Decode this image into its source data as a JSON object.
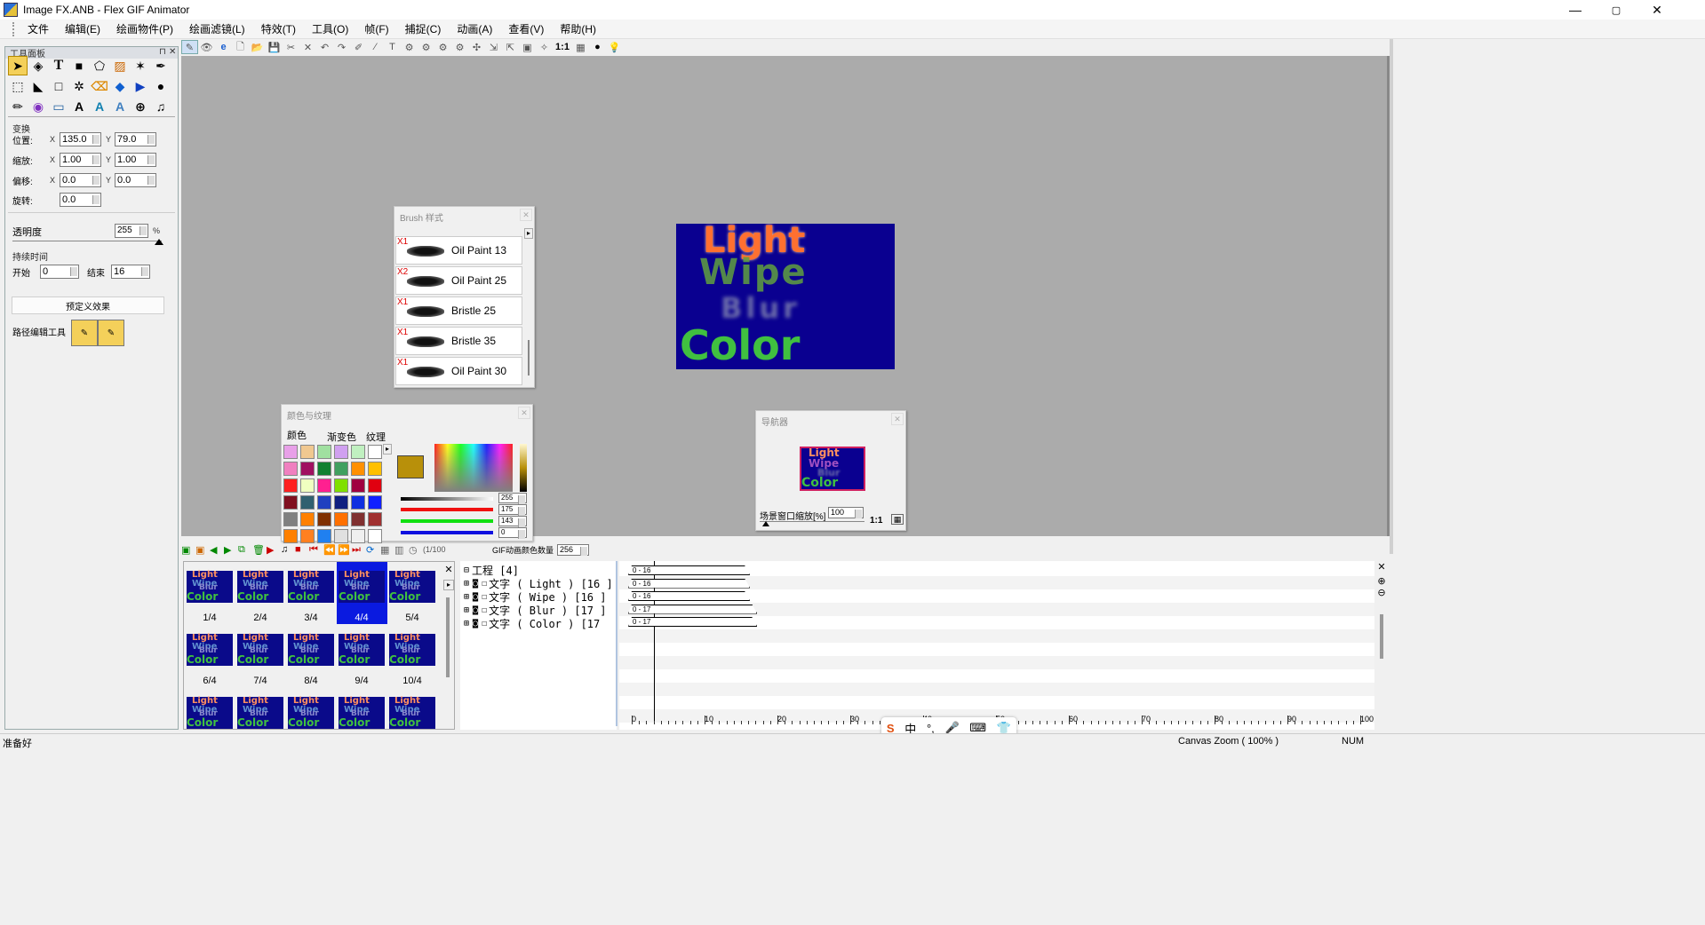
{
  "window": {
    "title": "Image FX.ANB - Flex GIF Animator",
    "min": "—",
    "max": "▢",
    "close": "✕"
  },
  "menu": [
    "文件",
    "编辑(E)",
    "绘画物件(P)",
    "绘画滤镜(L)",
    "特效(T)",
    "工具(O)",
    "帧(F)",
    "捕捉(C)",
    "动画(A)",
    "查看(V)",
    "帮助(H)"
  ],
  "toolpanel": {
    "title": "工具面板",
    "transform_label": "变换",
    "position_label": "位置:",
    "pos_x": "135.0",
    "pos_y": "79.0",
    "scale_label": "缩放:",
    "scale_x": "1.00",
    "scale_y": "1.00",
    "offset_label": "偏移:",
    "offset_x": "0.0",
    "offset_y": "0.0",
    "rotate_label": "旋转:",
    "rotate": "0.0",
    "x": "X",
    "y": "Y",
    "opacity_label": "透明度",
    "opacity_value": "255",
    "percent": "%",
    "duration_label": "持续时间",
    "start_label": "开始",
    "start_value": "0",
    "end_label": "结束",
    "end_value": "16",
    "preset_button": "预定义效果",
    "path_tool_label": "路径编辑工具"
  },
  "brush_window": {
    "title": "Brush 样式",
    "items": [
      {
        "mark": "X1",
        "label": "Oil Paint 13"
      },
      {
        "mark": "X2",
        "label": "Oil Paint 25"
      },
      {
        "mark": "X1",
        "label": "Bristle 25"
      },
      {
        "mark": "X1",
        "label": "Bristle 35"
      },
      {
        "mark": "X1",
        "label": "Oil Paint 30"
      }
    ]
  },
  "color_window": {
    "title": "颜色与纹理",
    "tabs": [
      "颜色",
      "渐变色",
      "纹理"
    ],
    "current_color": "#b8900a",
    "values": [
      "255",
      "175",
      "143",
      "0"
    ],
    "swatches": [
      [
        "#e8a0e8",
        "#f0c890",
        "#a0e0a0",
        "#d0a0f0",
        "#c0f0c0",
        "#ffffff"
      ],
      [
        "#f080c0",
        "#a01060",
        "#108030",
        "#40a060",
        "#ff9000",
        "#ffc000"
      ],
      [
        "#ff2020",
        "#f0ffc0",
        "#ff2090",
        "#80e000",
        "#a00040",
        "#e00010"
      ],
      [
        "#801020",
        "#306070",
        "#2040c0",
        "#102080",
        "#1030e0",
        "#1020ff"
      ],
      [
        "#808080",
        "#ff8000",
        "#803000",
        "#ff7000",
        "#803030",
        "#a03030"
      ],
      [
        "#ff8000",
        "#ff8020",
        "#2080f0",
        "#e0e0e0",
        "#f0f0f0",
        "#ffffff"
      ]
    ]
  },
  "navigator": {
    "title": "导航器",
    "zoom_label": "场景窗口缩放[%]",
    "zoom_value": "100",
    "one_to_one": "1:1"
  },
  "preview": {
    "background": "#0a0090",
    "line1": "Light",
    "line2": "Wipe",
    "line3": "Blur",
    "line4": "Color"
  },
  "bottombar": {
    "frame_counter": "(1/100",
    "gif_colors_label": "GIF动画颜色数量",
    "gif_colors_value": "256"
  },
  "frames": [
    {
      "label": "1/4"
    },
    {
      "label": "2/4"
    },
    {
      "label": "3/4"
    },
    {
      "label": "4/4",
      "selected": true
    },
    {
      "label": "5/4"
    },
    {
      "label": "6/4"
    },
    {
      "label": "7/4"
    },
    {
      "label": "8/4"
    },
    {
      "label": "9/4"
    },
    {
      "label": "10/4"
    },
    {
      "label": ""
    },
    {
      "label": ""
    },
    {
      "label": ""
    },
    {
      "label": ""
    },
    {
      "label": ""
    }
  ],
  "tree": {
    "root": "工程 [4]",
    "rows": [
      "文字 ( Light ) [16 ]",
      "文字 ( Wipe ) [16 ]",
      "文字 ( Blur ) [17 ]",
      "文字 ( Color ) [17"
    ]
  },
  "timeline": {
    "bars": [
      "0 - 16",
      "0 - 16",
      "0 - 16",
      "0 - 17",
      "0 - 17"
    ],
    "ruler": [
      "0",
      "10",
      "20",
      "30",
      "40",
      "50",
      "60",
      "70",
      "80",
      "90",
      "100"
    ]
  },
  "ime": [
    "S",
    "中",
    "°,",
    "🎤",
    "⌨",
    "👕"
  ],
  "status": {
    "left": "准备好",
    "zoom": "Canvas Zoom ( 100% )",
    "num": "NUM"
  },
  "toolbar_one_to_one": "1:1"
}
